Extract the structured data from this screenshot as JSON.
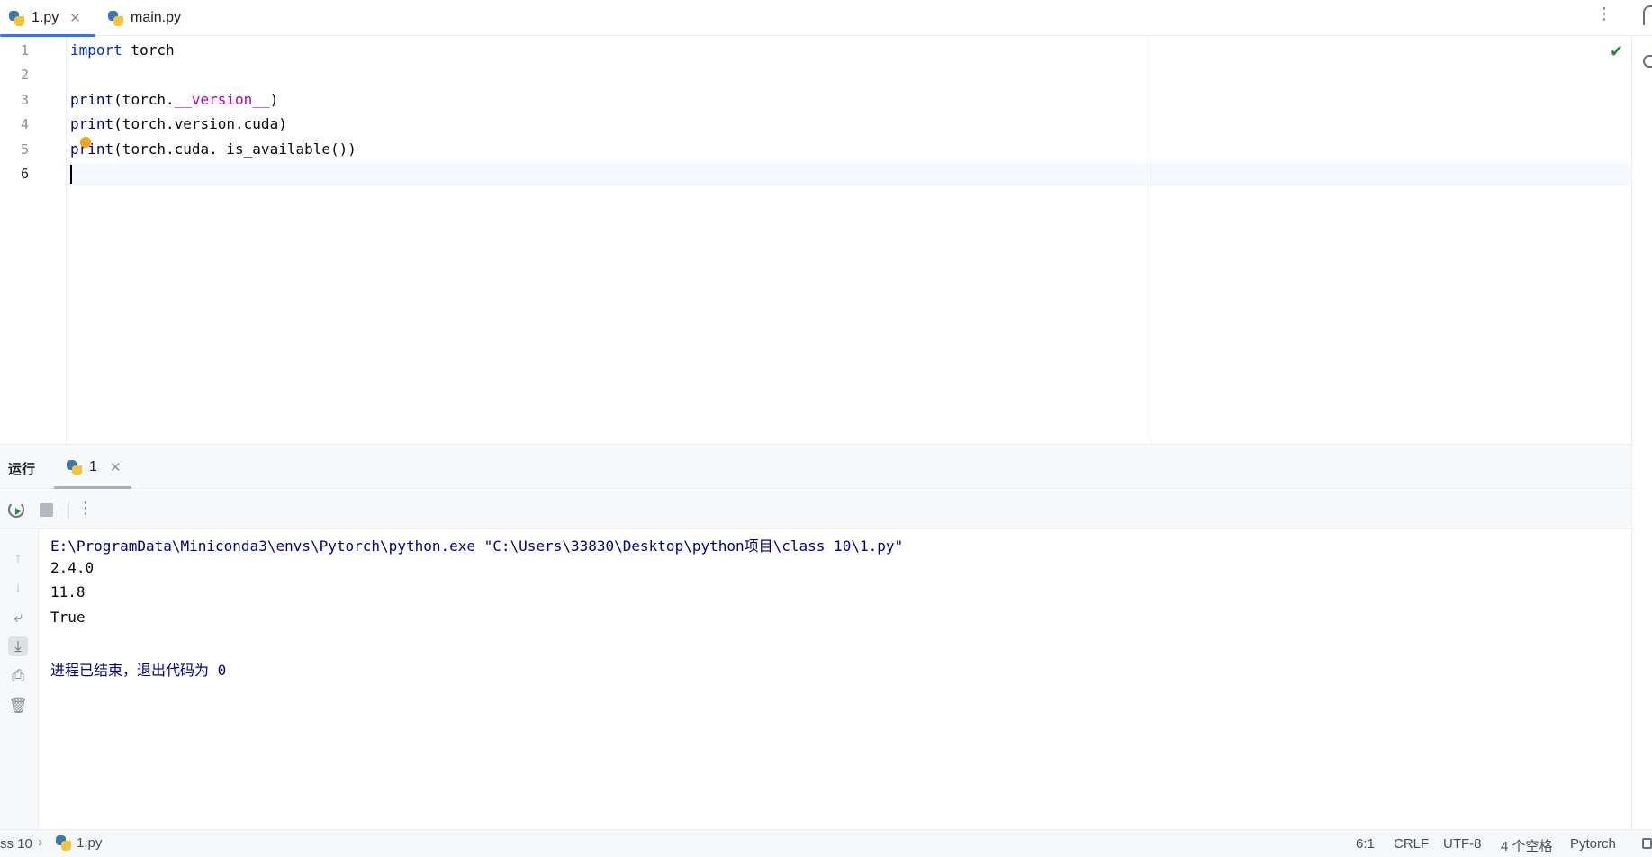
{
  "tabs": [
    {
      "label": "1.py",
      "active": true,
      "closable": true,
      "icon": "python-file-icon"
    },
    {
      "label": "main.py",
      "active": false,
      "closable": false,
      "icon": "python-file-icon"
    }
  ],
  "tab_close_glyph": "✕",
  "more_glyph": "⋮",
  "editor": {
    "line_numbers": [
      "1",
      "2",
      "3",
      "4",
      "5",
      "6"
    ],
    "current_line": 6,
    "lines": [
      {
        "kw": "import",
        "rest": " torch"
      },
      {
        "text": ""
      },
      {
        "fn": "print",
        "pre": "(torch.",
        "dunder": "__version__",
        "post": ")"
      },
      {
        "fn": "print",
        "rest": "(torch.version.cuda)"
      },
      {
        "fn": "print",
        "rest": "(torch.cuda. is_available())"
      },
      {
        "text": ""
      }
    ],
    "status_icon": "check-icon",
    "status_glyph": "✔"
  },
  "run_panel": {
    "title": "运行",
    "tab_label": "1",
    "toolbar": {
      "rerun": "rerun-icon",
      "stop": "stop-icon"
    },
    "sidebar_icons": [
      {
        "name": "scroll-up-icon",
        "glyph": "↑"
      },
      {
        "name": "scroll-down-icon",
        "glyph": "↓"
      },
      {
        "name": "soft-wrap-icon",
        "glyph": "⤶"
      },
      {
        "name": "scroll-to-end-icon",
        "glyph": "⤓"
      },
      {
        "name": "print-icon",
        "glyph": "⎙"
      },
      {
        "name": "trash-icon",
        "glyph": "🗑"
      }
    ],
    "console": {
      "command": "E:\\ProgramData\\Miniconda3\\envs\\Pytorch\\python.exe \"C:\\Users\\33830\\Desktop\\python项目\\class 10\\1.py\"",
      "output": [
        "2.4.0",
        "11.8",
        "True"
      ],
      "exit_message": "进程已结束，退出代码为 0"
    }
  },
  "statusbar": {
    "breadcrumb_project": "ss 10",
    "breadcrumb_sep": "›",
    "breadcrumb_file": "1.py",
    "position": "6:1",
    "line_separator": "CRLF",
    "encoding": "UTF-8",
    "indent": "4 个空格",
    "interpreter": "Pytorch"
  },
  "colors": {
    "accent": "#3574f0",
    "keyword": "#0033b3",
    "dunder": "#b200b2",
    "console_system": "#000080",
    "check": "#208a3c"
  }
}
